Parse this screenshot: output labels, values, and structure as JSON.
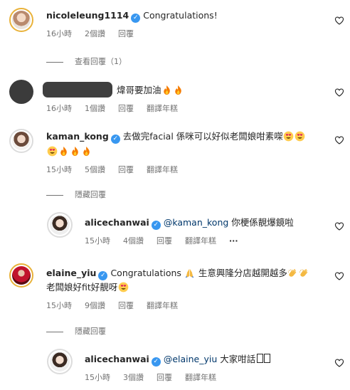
{
  "comments": [
    {
      "username": "nicoleleung1114",
      "text": "Congratulations!",
      "time": "16小時",
      "likes": "2個讚",
      "reply": "回覆",
      "view_replies": "查看回覆（1）"
    },
    {
      "username": "",
      "text": "煒哥要加油",
      "time": "16小時",
      "likes": "1個讚",
      "reply": "回覆",
      "translate": "翻譯年糕"
    },
    {
      "username": "kaman_kong",
      "text": "去做完facial 係咪可以好似老闆娘咁素㗎",
      "time": "15小時",
      "likes": "5個讚",
      "reply": "回覆",
      "translate": "翻譯年糕",
      "hide_replies": "隱藏回覆",
      "replies": [
        {
          "username": "alicechanwai",
          "mention": "@kaman_kong",
          "text": "你梗係靚爆鏡啦",
          "time": "15小時",
          "likes": "4個讚",
          "reply": "回覆",
          "translate": "翻譯年糕",
          "more": "···"
        }
      ]
    },
    {
      "username": "elaine_yiu",
      "text1": "Congratulations",
      "text2": "生意興隆分店越開越多",
      "text3": "老闆娘好fit好靚呀",
      "time": "15小時",
      "likes": "9個讚",
      "reply": "回覆",
      "translate": "翻譯年糕",
      "hide_replies": "隱藏回覆",
      "replies": [
        {
          "username": "alicechanwai",
          "mention": "@elaine_yiu",
          "text": "大家咁話",
          "time": "15小時",
          "likes": "3個讚",
          "reply": "回覆",
          "translate": "翻譯年糕"
        }
      ]
    }
  ],
  "colors": {
    "verified": "#3897f0",
    "meta": "#737373",
    "mention": "#00376b"
  },
  "icons": {
    "verified": "verified-badge-icon",
    "like": "heart-outline-icon",
    "fire": "fire-emoji",
    "heart_eyes": "heart-eyes-emoji",
    "clap": "clapping-hands-emoji",
    "pray": "praying-hands-emoji"
  }
}
